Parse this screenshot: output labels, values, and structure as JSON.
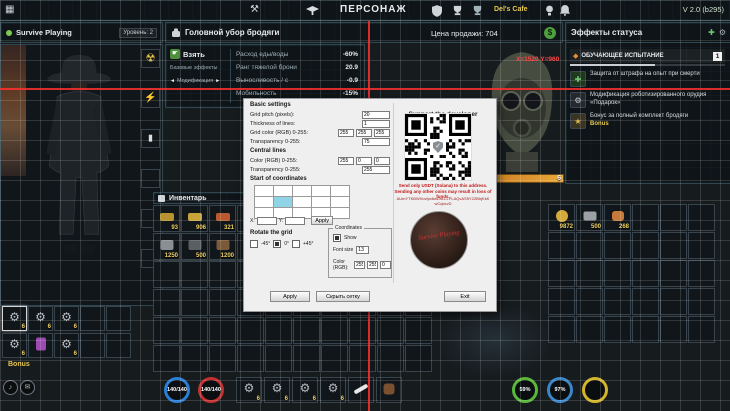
{
  "meta": {
    "version": "V 2.0 (b295)"
  },
  "icons": {
    "grid": "▦",
    "hammer": "⚒",
    "radiation": "☢",
    "gear": "⚙",
    "dollar": "$",
    "bolt": "⚡",
    "plus": "✚",
    "star": "★",
    "diamond": "◆",
    "pointer": "☛",
    "left_arrow": "◄",
    "right_arrow": "►",
    "note": "♪",
    "mail": "✉",
    "battery": "▮",
    "check": "✓"
  },
  "top_bar": {
    "title": "ПЕРСОНАЖ",
    "server": "Del's Cafe"
  },
  "player": {
    "name": "Survive Playing",
    "level": "Уровень: 2"
  },
  "item_panel": {
    "title": "Головной убор бродяги",
    "take": "Взять",
    "base_effects": "Базовые эффекты",
    "modification": "Модификация",
    "stats": [
      {
        "label": "Расход еды/воды",
        "value": "-60%"
      },
      {
        "label": "Ранг тяжелой брони",
        "value": "20.9"
      },
      {
        "label": "Выносливость / с",
        "value": "-0.9"
      },
      {
        "label": "Мобильность",
        "value": "-15%"
      }
    ],
    "price": "Цена продажи: 704",
    "quality": "6"
  },
  "status_panel": {
    "title": "Эффекты статуса",
    "challenge": {
      "name": "ОБУЧАЮЩЕЕ ИСПЫТАНИЕ",
      "count": "1"
    },
    "effects": [
      {
        "text": "Защита от штрафа на опыт при смерти",
        "badge": ""
      },
      {
        "text": "Модификация роботизированного орудия «Подарок»",
        "badge": ""
      },
      {
        "text": "Бонус за полный комплект бродяги",
        "badge": "Bonus"
      }
    ]
  },
  "overlay": {
    "coords": "X=1520 Y=960"
  },
  "dialog": {
    "title": "Basic settings",
    "grid_pitch_label": "Grid pitch (pixels):",
    "grid_pitch": "20",
    "thickness_label": "Thickness of lines:",
    "thickness": "1",
    "grid_color_label": "Grid color (RGB) 0-255:",
    "grid_r": "255",
    "grid_g": "255",
    "grid_b": "255",
    "grid_alpha_label": "Transparency 0-255:",
    "grid_alpha": "75",
    "central_title": "Central lines",
    "central_color_label": "Color (RGB) 0-255:",
    "central_r": "255",
    "central_g": "0",
    "central_b": "0",
    "central_alpha_label": "Transparency 0-255:",
    "central_alpha": "255",
    "origin_title": "Start of coordinates",
    "x_label": "X:",
    "y_label": "Y:",
    "apply_xy": "Apply",
    "rotate_title": "Rotate the grid",
    "rotate_options": [
      "-45°",
      "0°",
      "+45°"
    ],
    "coords_title": "Coordinates",
    "show_label": "Show",
    "font_size_label": "Font size",
    "font_size": "13",
    "coord_color_label": "Color (RGB):",
    "coord_r": "255",
    "coord_g": "255",
    "coord_b": "0",
    "apply": "Apply",
    "hide_grid": "Скрыть сетку",
    "exit": "Exit",
    "support": {
      "title": "Support the developer",
      "warning1": "Send only USDT (Solana) to this address.",
      "warning2": "Sending any other coins may result in loss of funds.",
      "address": "AUmYTKBWVuvfpx6wDnLLLPLAQvAS5Y2ZBhjKkKwCqbcvD",
      "avatar_caption": "Survive Playing"
    }
  },
  "inventory": {
    "title": "Инвентарь",
    "items": [
      {
        "count": "93"
      },
      {
        "count": "906"
      },
      {
        "count": "321"
      },
      {
        "count": "1250"
      },
      {
        "count": "500"
      },
      {
        "count": "1200"
      }
    ]
  },
  "storage": {
    "counts": [
      "9872",
      "500",
      "268"
    ]
  },
  "quick_slots": {
    "count": "6",
    "bonus": "Bonus"
  },
  "toolbar": {
    "health": "140/140",
    "stamina": "140/140",
    "slot_count": "6",
    "food": "59%",
    "water": "97%"
  }
}
